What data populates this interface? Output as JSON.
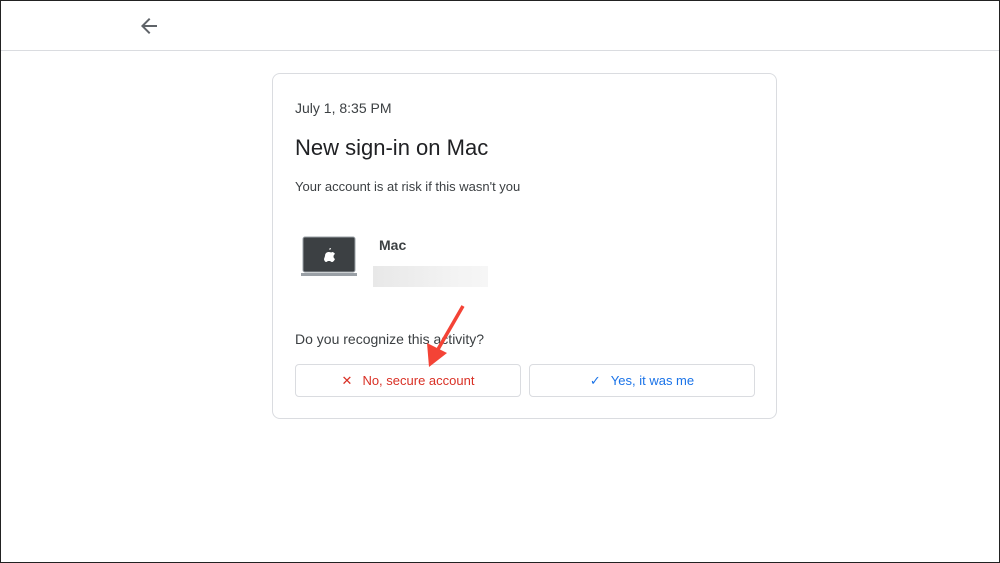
{
  "header": {
    "back_icon": "arrow-left-icon"
  },
  "card": {
    "date": "July 1, 8:35 PM",
    "title": "New sign-in on Mac",
    "subtitle": "Your account is at risk if this wasn't you",
    "device_name": "Mac",
    "device_icon": "laptop-apple-icon",
    "question": "Do you recognize this activity?",
    "no_button": "No, secure account",
    "yes_button": "Yes, it was me"
  },
  "colors": {
    "danger": "#d93025",
    "primary": "#1a73e8",
    "annotation": "#f44336"
  }
}
